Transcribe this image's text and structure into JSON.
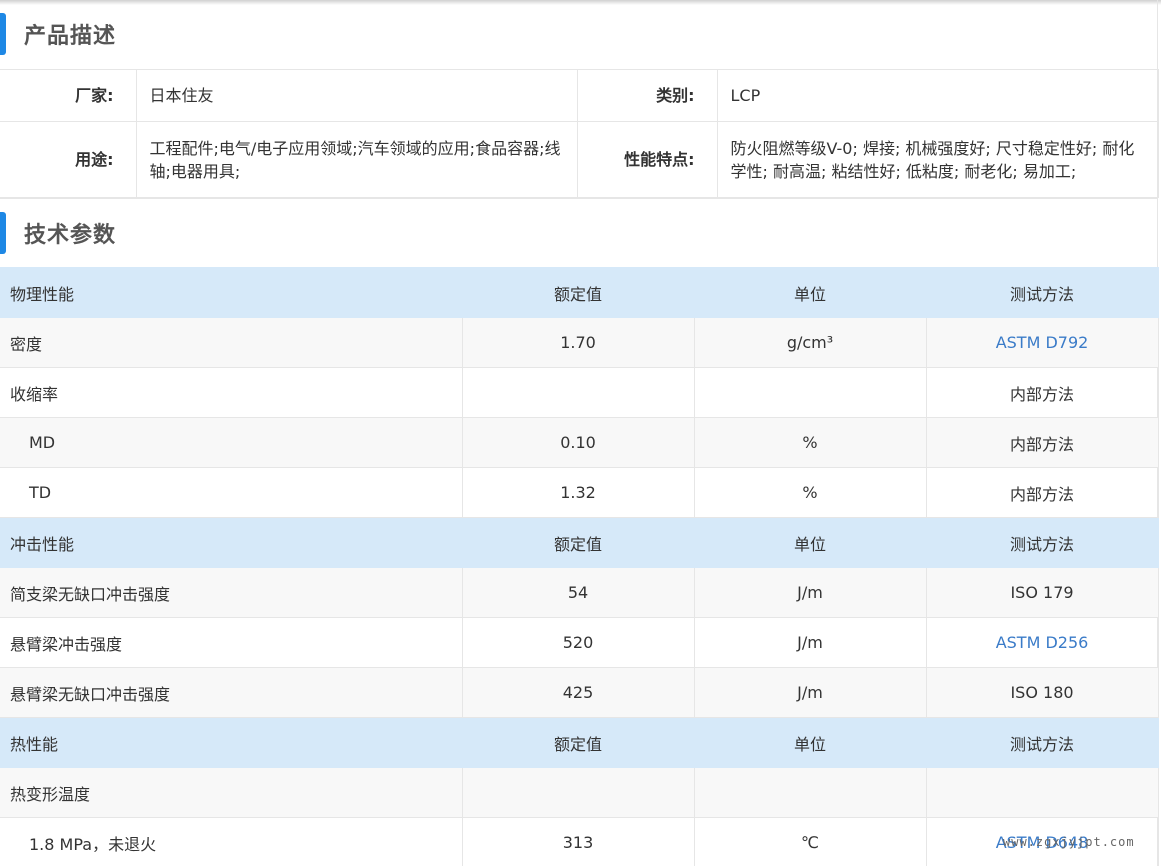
{
  "sections": {
    "description_title": "产品描述",
    "tech_title": "技术参数"
  },
  "description": {
    "manufacturer_label": "厂家:",
    "manufacturer_value": "日本住友",
    "category_label": "类别:",
    "category_value": "LCP",
    "usage_label": "用途:",
    "usage_value": "工程配件;电气/电子应用领域;汽车领域的应用;食品容器;线轴;电器用具;",
    "features_label": "性能特点:",
    "features_value": "防火阻燃等级V-0; 焊接; 机械强度好; 尺寸稳定性好; 耐化学性; 耐高温; 粘结性好; 低粘度; 耐老化; 易加工;"
  },
  "tech_table": {
    "rows": [
      {
        "type": "header",
        "name": "物理性能",
        "value": "额定值",
        "unit": "单位",
        "method": "测试方法"
      },
      {
        "type": "data",
        "name": "密度",
        "value": "1.70",
        "unit": "g/cm³",
        "method": "ASTM D792",
        "method_link": true
      },
      {
        "type": "data",
        "name": "收缩率",
        "value": "",
        "unit": "",
        "method": "内部方法",
        "method_link": false
      },
      {
        "type": "data",
        "name": "MD",
        "value": "0.10",
        "unit": "%",
        "method": "内部方法",
        "method_link": false,
        "indent": true
      },
      {
        "type": "data",
        "name": "TD",
        "value": "1.32",
        "unit": "%",
        "method": "内部方法",
        "method_link": false,
        "indent": true
      },
      {
        "type": "header",
        "name": "冲击性能",
        "value": "额定值",
        "unit": "单位",
        "method": "测试方法"
      },
      {
        "type": "data",
        "name": "简支梁无缺口冲击强度",
        "value": "54",
        "unit": "J/m",
        "method": "ISO 179",
        "method_link": false
      },
      {
        "type": "data",
        "name": "悬臂梁冲击强度",
        "value": "520",
        "unit": "J/m",
        "method": "ASTM D256",
        "method_link": true
      },
      {
        "type": "data",
        "name": "悬臂梁无缺口冲击强度",
        "value": "425",
        "unit": "J/m",
        "method": "ISO 180",
        "method_link": false
      },
      {
        "type": "header",
        "name": "热性能",
        "value": "额定值",
        "unit": "单位",
        "method": "测试方法"
      },
      {
        "type": "data",
        "name": "热变形温度",
        "value": "",
        "unit": "",
        "method": "",
        "method_link": false
      },
      {
        "type": "data",
        "name": "1.8 MPa，未退火",
        "value": "313",
        "unit": "℃",
        "method": "ASTM D648",
        "method_link": true,
        "indent": true
      }
    ]
  },
  "watermark": "www.zgxjyjpt.com",
  "colors": {
    "accent": "#1e88e5",
    "header_row_bg": "#d6e9f9",
    "alt_row_bg": "#f8f8f8",
    "link": "#3a7bc8"
  }
}
